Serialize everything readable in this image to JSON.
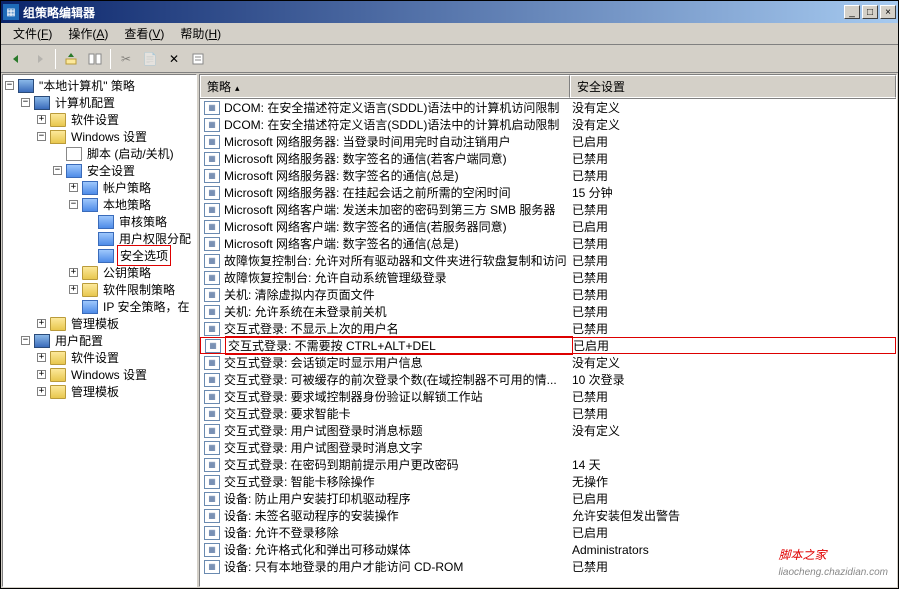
{
  "window": {
    "title": "组策略编辑器"
  },
  "menu": {
    "file": "文件",
    "file_u": "F",
    "action": "操作",
    "action_u": "A",
    "view": "查看",
    "view_u": "V",
    "help": "帮助",
    "help_u": "H"
  },
  "tree": {
    "root": "\"本地计算机\" 策略",
    "computerConfig": "计算机配置",
    "softwareSettings": "软件设置",
    "windowsSettings": "Windows 设置",
    "scripts": "脚本 (启动/关机)",
    "securitySettings": "安全设置",
    "accountPolicy": "帐户策略",
    "localPolicy": "本地策略",
    "auditPolicy": "审核策略",
    "userRights": "用户权限分配",
    "securityOptions": "安全选项",
    "publicKey": "公钥策略",
    "softwareRestriction": "软件限制策略",
    "ipSecurity": "IP 安全策略，在",
    "adminTemplates": "管理模板",
    "userConfig": "用户配置"
  },
  "list": {
    "header": {
      "policy": "策略",
      "setting": "安全设置"
    },
    "rows": [
      {
        "p": "DCOM: 在安全描述符定义语言(SDDL)语法中的计算机访问限制",
        "v": "没有定义"
      },
      {
        "p": "DCOM: 在安全描述符定义语言(SDDL)语法中的计算机启动限制",
        "v": "没有定义"
      },
      {
        "p": "Microsoft 网络服务器: 当登录时间用完时自动注销用户",
        "v": "已启用"
      },
      {
        "p": "Microsoft 网络服务器: 数字签名的通信(若客户端同意)",
        "v": "已禁用"
      },
      {
        "p": "Microsoft 网络服务器: 数字签名的通信(总是)",
        "v": "已禁用"
      },
      {
        "p": "Microsoft 网络服务器: 在挂起会话之前所需的空闲时间",
        "v": "15 分钟"
      },
      {
        "p": "Microsoft 网络客户端: 发送未加密的密码到第三方 SMB 服务器",
        "v": "已禁用"
      },
      {
        "p": "Microsoft 网络客户端: 数字签名的通信(若服务器同意)",
        "v": "已启用"
      },
      {
        "p": "Microsoft 网络客户端: 数字签名的通信(总是)",
        "v": "已禁用"
      },
      {
        "p": "故障恢复控制台: 允许对所有驱动器和文件夹进行软盘复制和访问",
        "v": "已禁用"
      },
      {
        "p": "故障恢复控制台: 允许自动系统管理级登录",
        "v": "已禁用"
      },
      {
        "p": "关机: 清除虚拟内存页面文件",
        "v": "已禁用"
      },
      {
        "p": "关机: 允许系统在未登录前关机",
        "v": "已禁用"
      },
      {
        "p": "交互式登录: 不显示上次的用户名",
        "v": "已禁用"
      },
      {
        "p": "交互式登录: 不需要按 CTRL+ALT+DEL",
        "v": "已启用",
        "hl": true
      },
      {
        "p": "交互式登录: 会话锁定时显示用户信息",
        "v": "没有定义"
      },
      {
        "p": "交互式登录: 可被缓存的前次登录个数(在域控制器不可用的情...",
        "v": "10 次登录"
      },
      {
        "p": "交互式登录: 要求域控制器身份验证以解锁工作站",
        "v": "已禁用"
      },
      {
        "p": "交互式登录: 要求智能卡",
        "v": "已禁用"
      },
      {
        "p": "交互式登录: 用户试图登录时消息标题",
        "v": "没有定义"
      },
      {
        "p": "交互式登录: 用户试图登录时消息文字",
        "v": ""
      },
      {
        "p": "交互式登录: 在密码到期前提示用户更改密码",
        "v": "14 天"
      },
      {
        "p": "交互式登录: 智能卡移除操作",
        "v": "无操作"
      },
      {
        "p": "设备: 防止用户安装打印机驱动程序",
        "v": "已启用"
      },
      {
        "p": "设备: 未签名驱动程序的安装操作",
        "v": "允许安装但发出警告"
      },
      {
        "p": "设备: 允许不登录移除",
        "v": "已启用"
      },
      {
        "p": "设备: 允许格式化和弹出可移动媒体",
        "v": "Administrators"
      },
      {
        "p": "设备: 只有本地登录的用户才能访问 CD-ROM",
        "v": "已禁用"
      }
    ]
  },
  "watermark": {
    "text": "脚本之家",
    "sub": "liaocheng.chazidian.com"
  }
}
